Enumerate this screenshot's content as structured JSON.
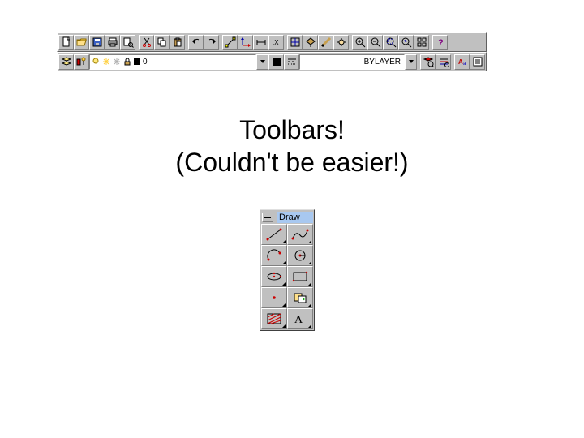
{
  "caption": {
    "line1": "Toolbars!",
    "line2": "(Couldn't be easier!)"
  },
  "standard_toolbar": {
    "buttons": [
      "new",
      "open",
      "save",
      "print",
      "preview",
      "cut",
      "copy",
      "paste",
      "undo",
      "redo",
      "snap",
      "ucs",
      "dist",
      "list",
      "area",
      "aerial",
      "orbit",
      "select",
      "pan",
      "zoom-in",
      "zoom-out",
      "zoom-window",
      "zoom-prev",
      "zoom-all",
      "help"
    ]
  },
  "layer_toolbar": {
    "layer_control": {
      "name": "0"
    },
    "linetype_control": {
      "name": "BYLAYER"
    }
  },
  "draw_palette": {
    "title": "Draw",
    "tools": [
      "line",
      "pline",
      "arc",
      "circle",
      "ellipse",
      "rectangle",
      "point",
      "block",
      "hatch",
      "text"
    ]
  }
}
